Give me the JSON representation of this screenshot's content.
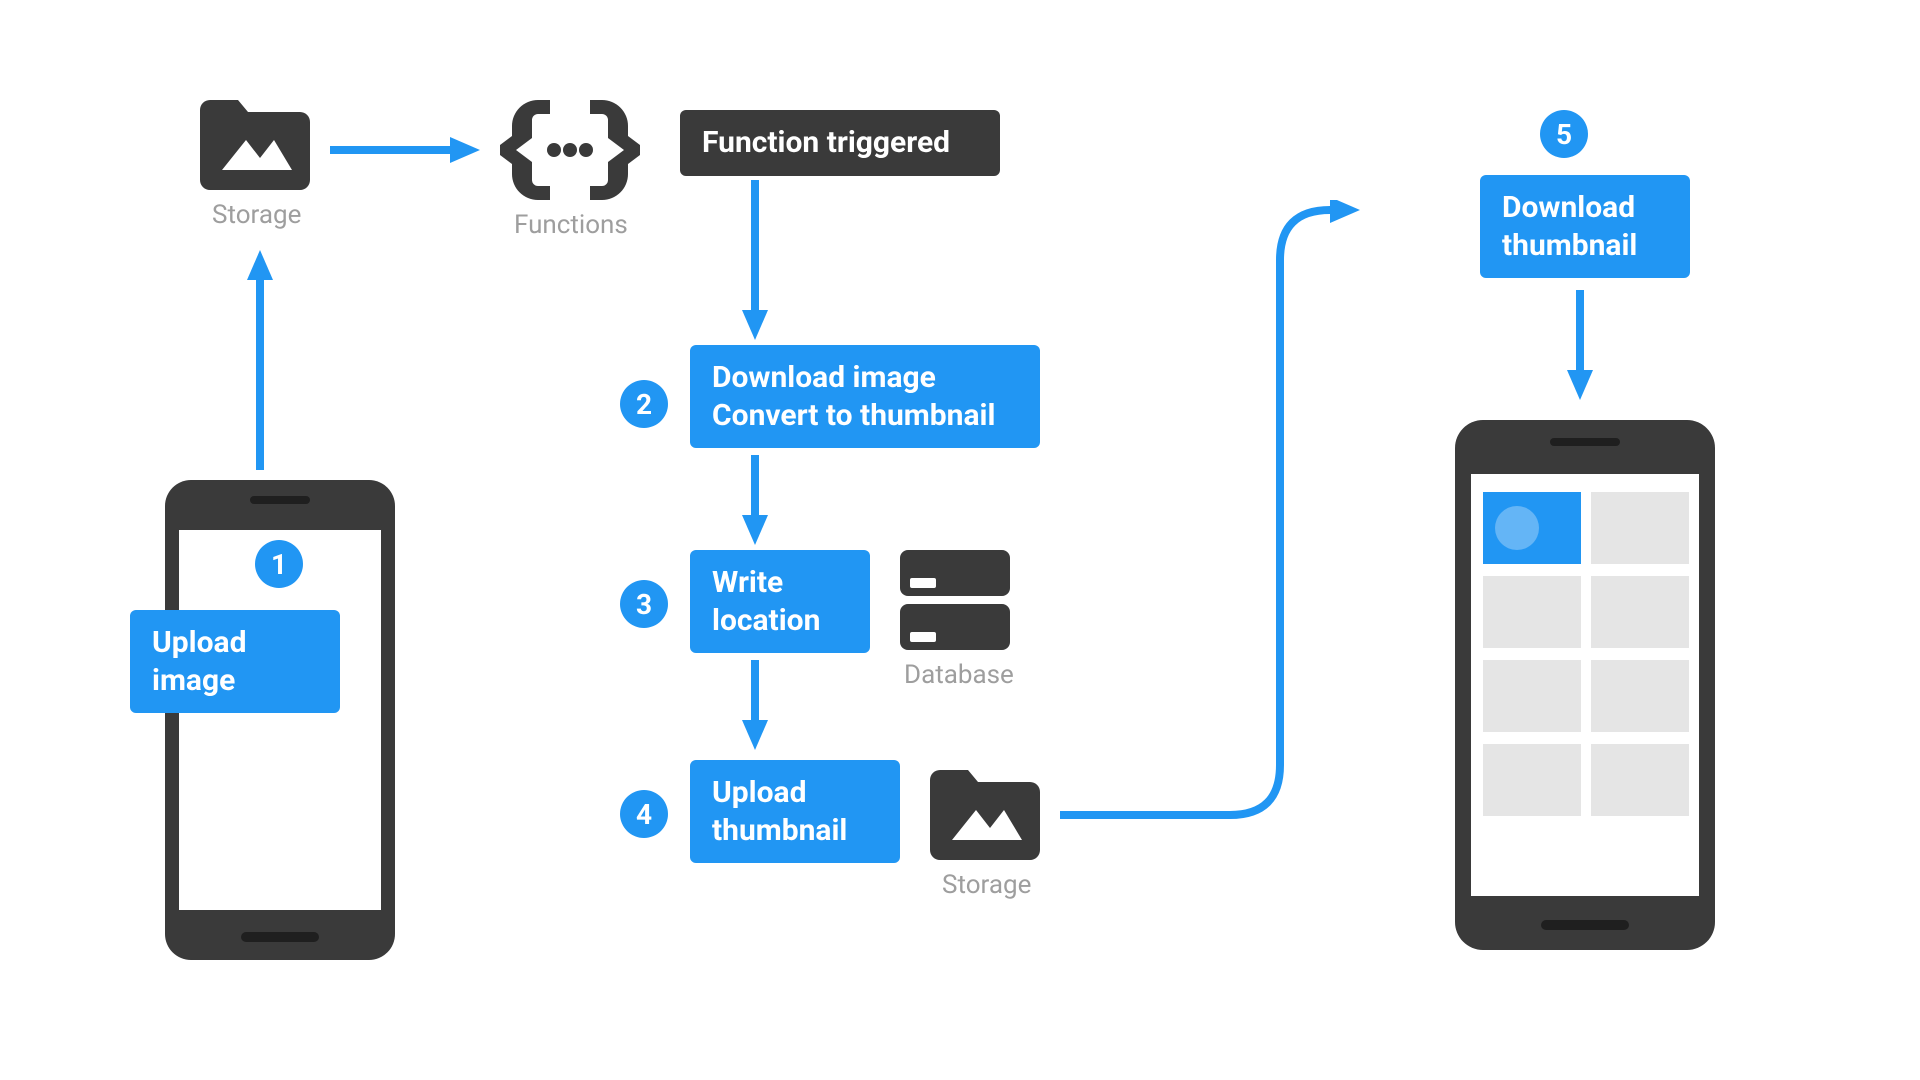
{
  "labels": {
    "storage1": "Storage",
    "functions": "Functions",
    "database": "Database",
    "storage2": "Storage"
  },
  "boxes": {
    "trigger": "Function triggered",
    "upload_image": "Upload\nimage",
    "download_convert": "Download image\nConvert to thumbnail",
    "write_location": "Write\nlocation",
    "upload_thumbnail": "Upload\nthumbnail",
    "download_thumbnail": "Download\nthumbnail"
  },
  "steps": {
    "s1": "1",
    "s2": "2",
    "s3": "3",
    "s4": "4",
    "s5": "5"
  },
  "colors": {
    "blue": "#2196f3",
    "dark": "#3a3a3a",
    "grey": "#9e9e9e",
    "softgrey": "#e5e5e5"
  }
}
